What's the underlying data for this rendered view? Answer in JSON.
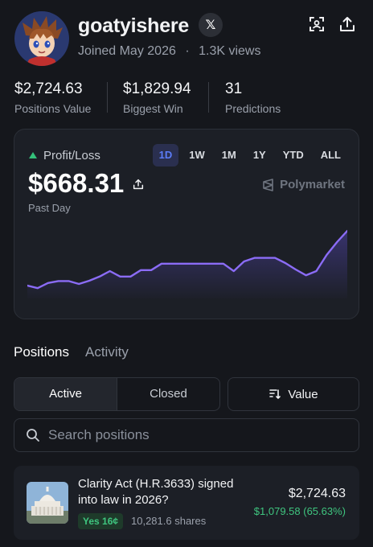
{
  "profile": {
    "username": "goatyishere",
    "social_icon": "x-logo-icon",
    "joined": "Joined May 2026",
    "separator": "·",
    "views": "1.3K views"
  },
  "header_icons": [
    "scan-icon",
    "share-icon"
  ],
  "stats": [
    {
      "value": "$2,724.63",
      "label": "Positions Value"
    },
    {
      "value": "$1,829.94",
      "label": "Biggest Win"
    },
    {
      "value": "31",
      "label": "Predictions"
    }
  ],
  "pnl_card": {
    "label": "Profit/Loss",
    "value": "$668.31",
    "period": "Past Day",
    "brand": "Polymarket",
    "ranges": [
      "1D",
      "1W",
      "1M",
      "1Y",
      "YTD",
      "ALL"
    ],
    "active_range": "1D",
    "colors": {
      "line": "#8b6cf6",
      "up": "#34c07a",
      "active_range": "#5b7cf7"
    }
  },
  "chart_data": {
    "type": "area",
    "title": "",
    "xlabel": "",
    "ylabel": "",
    "x": [
      0,
      1,
      2,
      3,
      4,
      5,
      6,
      7,
      8,
      9,
      10,
      11,
      12,
      13,
      14,
      15,
      16,
      17,
      18,
      19,
      20,
      21,
      22,
      23,
      24,
      25,
      26,
      27,
      28,
      29,
      30,
      31,
      32,
      33,
      34,
      35,
      36,
      37,
      38,
      39
    ],
    "values": [
      0,
      -0.8,
      0.8,
      1.4,
      1.4,
      0.5,
      1.5,
      2.8,
      4.5,
      2.8,
      2.8,
      4.8,
      4.8,
      6.8,
      6.8,
      6.8,
      6.8,
      6.8,
      6.8,
      6.8,
      4.5,
      7.5,
      8.6,
      8.6,
      8.6,
      7.0,
      5.0,
      3.2,
      4.5,
      9.5,
      13.5,
      17
    ],
    "ylim": [
      -1.5,
      17.5
    ]
  },
  "tabs": [
    {
      "label": "Positions",
      "active": true
    },
    {
      "label": "Activity",
      "active": false
    }
  ],
  "filters": {
    "active_label": "Active",
    "closed_label": "Closed",
    "sort_label": "Value",
    "sort_icon": "sort-icon"
  },
  "search": {
    "placeholder": "Search positions",
    "value": ""
  },
  "positions": [
    {
      "title": "Clarity Act (H.R.3633) signed into law in 2026?",
      "outcome": "Yes 16¢",
      "shares": "10,281.6 shares",
      "value": "$2,724.63",
      "pnl": "$1,079.58 (65.63%)",
      "thumb_icon": "capitol-building-icon"
    }
  ]
}
